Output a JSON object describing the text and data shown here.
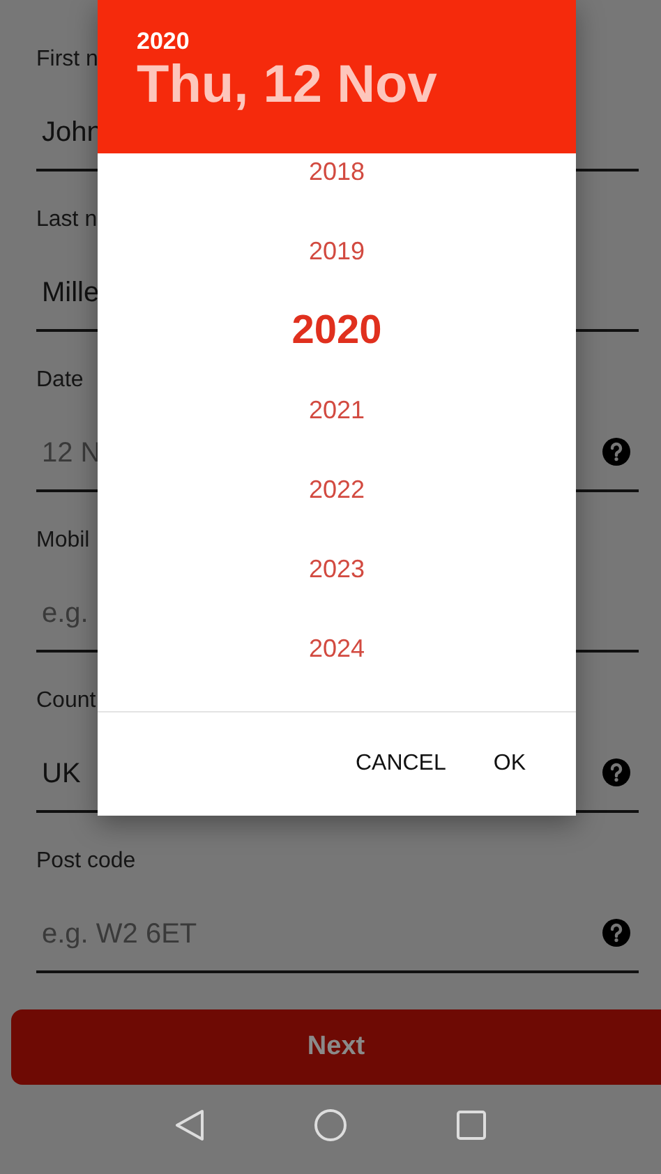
{
  "form": {
    "fields": [
      {
        "label": "First n",
        "value": "John",
        "help": false
      },
      {
        "label": "Last n",
        "value": "Mille",
        "help": false
      },
      {
        "label": "Date",
        "placeholder": "12 N",
        "help": true
      },
      {
        "label": "Mobil",
        "placeholder": "e.g.",
        "help": false
      },
      {
        "label": "Count",
        "value": "UK",
        "help": true
      },
      {
        "label": "Post code",
        "placeholder": "e.g. W2 6ET",
        "help": true
      }
    ],
    "next_button": {
      "label": "Next",
      "disabled": true
    }
  },
  "date_picker": {
    "header_year": "2020",
    "header_date": "Thu, 12 Nov",
    "years": [
      {
        "label": "2018",
        "selected": false
      },
      {
        "label": "2019",
        "selected": false
      },
      {
        "label": "2020",
        "selected": true
      },
      {
        "label": "2021",
        "selected": false
      },
      {
        "label": "2022",
        "selected": false
      },
      {
        "label": "2023",
        "selected": false
      },
      {
        "label": "2024",
        "selected": false
      }
    ],
    "buttons": [
      {
        "label": "CANCEL"
      },
      {
        "label": "OK"
      }
    ]
  }
}
